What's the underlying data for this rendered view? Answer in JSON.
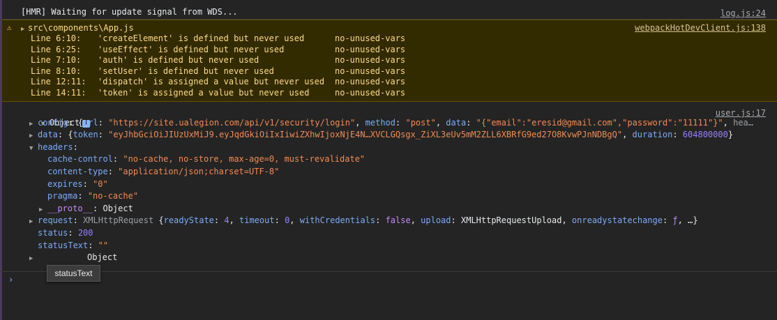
{
  "log": {
    "message": "[HMR] Waiting for update signal from WDS...",
    "source": "log.js:24"
  },
  "warning": {
    "file": "src\\components\\App.js",
    "source": "webpackHotDevClient.js:138",
    "lines": [
      {
        "loc": "Line 6:10:",
        "msg": "'createElement' is defined but never used",
        "rule": "no-unused-vars"
      },
      {
        "loc": "Line 6:25:",
        "msg": "'useEffect' is defined but never used",
        "rule": "no-unused-vars"
      },
      {
        "loc": "Line 7:10:",
        "msg": "'auth' is defined but never used",
        "rule": "no-unused-vars"
      },
      {
        "loc": "Line 8:10:",
        "msg": "'setUser' is defined but never used",
        "rule": "no-unused-vars"
      },
      {
        "loc": "Line 12:11:",
        "msg": "'dispatch' is assigned a value but never used",
        "rule": "no-unused-vars"
      },
      {
        "loc": "Line 14:11:",
        "msg": "'token' is assigned a value but never used",
        "rule": "no-unused-vars"
      }
    ]
  },
  "object": {
    "source": "user.js:17",
    "label": "Object",
    "info_badge": "i",
    "config": {
      "key": "config",
      "url_key": "url",
      "url": "\"https://site.ualegion.com/api/v1/security/login\"",
      "method_key": "method",
      "method": "\"post\"",
      "data_key": "data",
      "data": "\"{\"email\":\"eresid@gmail.com\",\"password\":\"11111\"}\"",
      "tail": "hea…"
    },
    "data": {
      "key": "data",
      "token_key": "token",
      "token": "\"eyJhbGciOiJIUzUxMiJ9.eyJqdGkiOiIxIiwiZXhwIjoxNjE4N…XVCLGQsgx_ZiXL3eUv5mM2ZLL6XBRfG9ed27O8KvwPJnNDBgQ\"",
      "duration_key": "duration",
      "duration": "604800000"
    },
    "headers": {
      "key": "headers",
      "cache_control_key": "cache-control",
      "cache_control": "\"no-cache, no-store, max-age=0, must-revalidate\"",
      "content_type_key": "content-type",
      "content_type": "\"application/json;charset=UTF-8\"",
      "expires_key": "expires",
      "expires": "\"0\"",
      "pragma_key": "pragma",
      "pragma": "\"no-cache\"",
      "proto_key": "__proto__",
      "proto_val": "Object"
    },
    "request": {
      "key": "request",
      "type": "XMLHttpRequest",
      "ready_key": "readyState",
      "ready": "4",
      "timeout_key": "timeout",
      "timeout": "0",
      "creds_key": "withCredentials",
      "creds": "false",
      "upload_key": "upload",
      "upload": "XMLHttpRequestUpload",
      "orsc_key": "onreadystatechange",
      "orsc": "ƒ",
      "tail": "…}"
    },
    "status_key": "status",
    "status": "200",
    "status_text_key": "statusText",
    "status_text": "\"\"",
    "proto_val": "Object"
  },
  "tooltip": "statusText",
  "prompt_icon": "chevron-right-icon"
}
